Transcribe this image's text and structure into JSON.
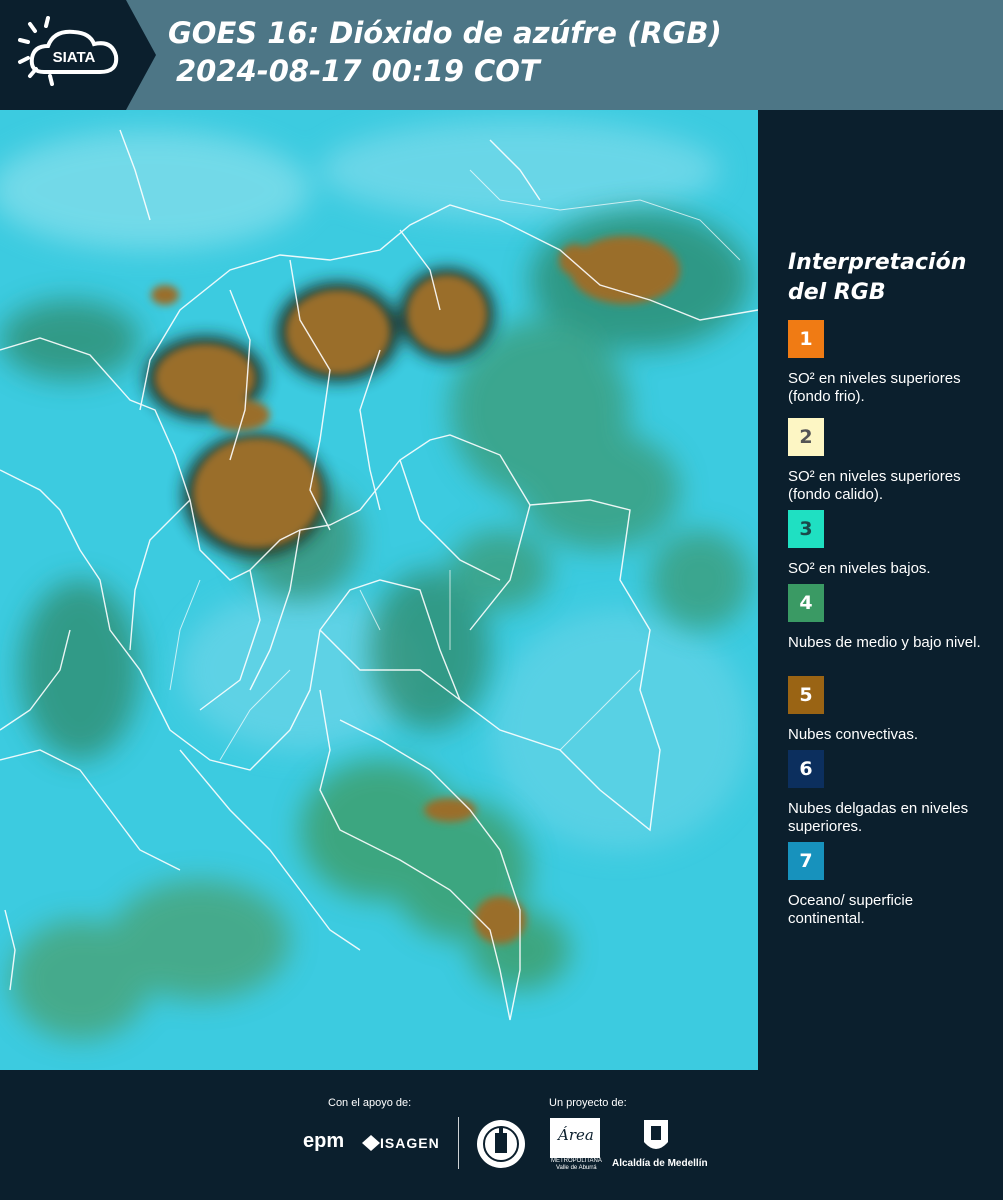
{
  "header": {
    "logo_text": "SIATA",
    "title_line1": "GOES 16: Dióxido de azúfre (RGB)",
    "title_line2": "2024-08-17 00:19 COT"
  },
  "legend": {
    "title_line1": "Interpretación",
    "title_line2": "del RGB",
    "items": [
      {
        "num": "1",
        "color": "#f07b14",
        "text": "SO² en niveles superiores (fondo frio)."
      },
      {
        "num": "2",
        "color": "#fdf6c4",
        "text": "SO² en niveles superiores (fondo calido)."
      },
      {
        "num": "3",
        "color": "#1fe0c2",
        "text": "SO² en niveles bajos."
      },
      {
        "num": "4",
        "color": "#3a9a64",
        "text": "Nubes de medio y bajo nivel."
      },
      {
        "num": "5",
        "color": "#9a6414",
        "text": "Nubes convectivas."
      },
      {
        "num": "6",
        "color": "#0c2f5e",
        "text": "Nubes delgadas en niveles superiores."
      },
      {
        "num": "7",
        "color": "#1792bd",
        "text": "Oceano/ superficie continental."
      }
    ]
  },
  "footer": {
    "support_caption": "Con el apoyo de:",
    "project_caption": "Un proyecto de:",
    "epm": "epm",
    "isagen": "ISAGEN",
    "area_script": "Área",
    "area_sub1": "METROPOLITANA",
    "area_sub2": "Valle de Aburrá",
    "alcaldia": "Alcaldía de Medellín"
  }
}
